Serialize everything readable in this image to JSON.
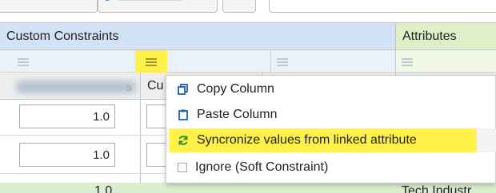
{
  "grid": {
    "group_headers": {
      "custom_constraints": "Custom Constraints",
      "attributes": "Attributes"
    },
    "column_header_cut": "Cu",
    "rows": [
      {
        "value": "1.0"
      },
      {
        "value": "1.0"
      }
    ],
    "partial_row_value": "1.0",
    "partial_row_attr_text": "Tech Industr"
  },
  "context_menu": {
    "items": [
      {
        "label": "Copy Column",
        "icon": "copy-icon"
      },
      {
        "label": "Paste Column",
        "icon": "paste-icon"
      },
      {
        "label": "Syncronize values from linked attribute",
        "icon": "sync-icon",
        "highlighted": true
      },
      {
        "label": "Ignore (Soft Constraint)",
        "icon": "checkbox-icon"
      }
    ]
  },
  "colors": {
    "highlight": "#fff14a",
    "accent_blue": "#1e5fb8",
    "sync_green": "#3a8a1f"
  }
}
